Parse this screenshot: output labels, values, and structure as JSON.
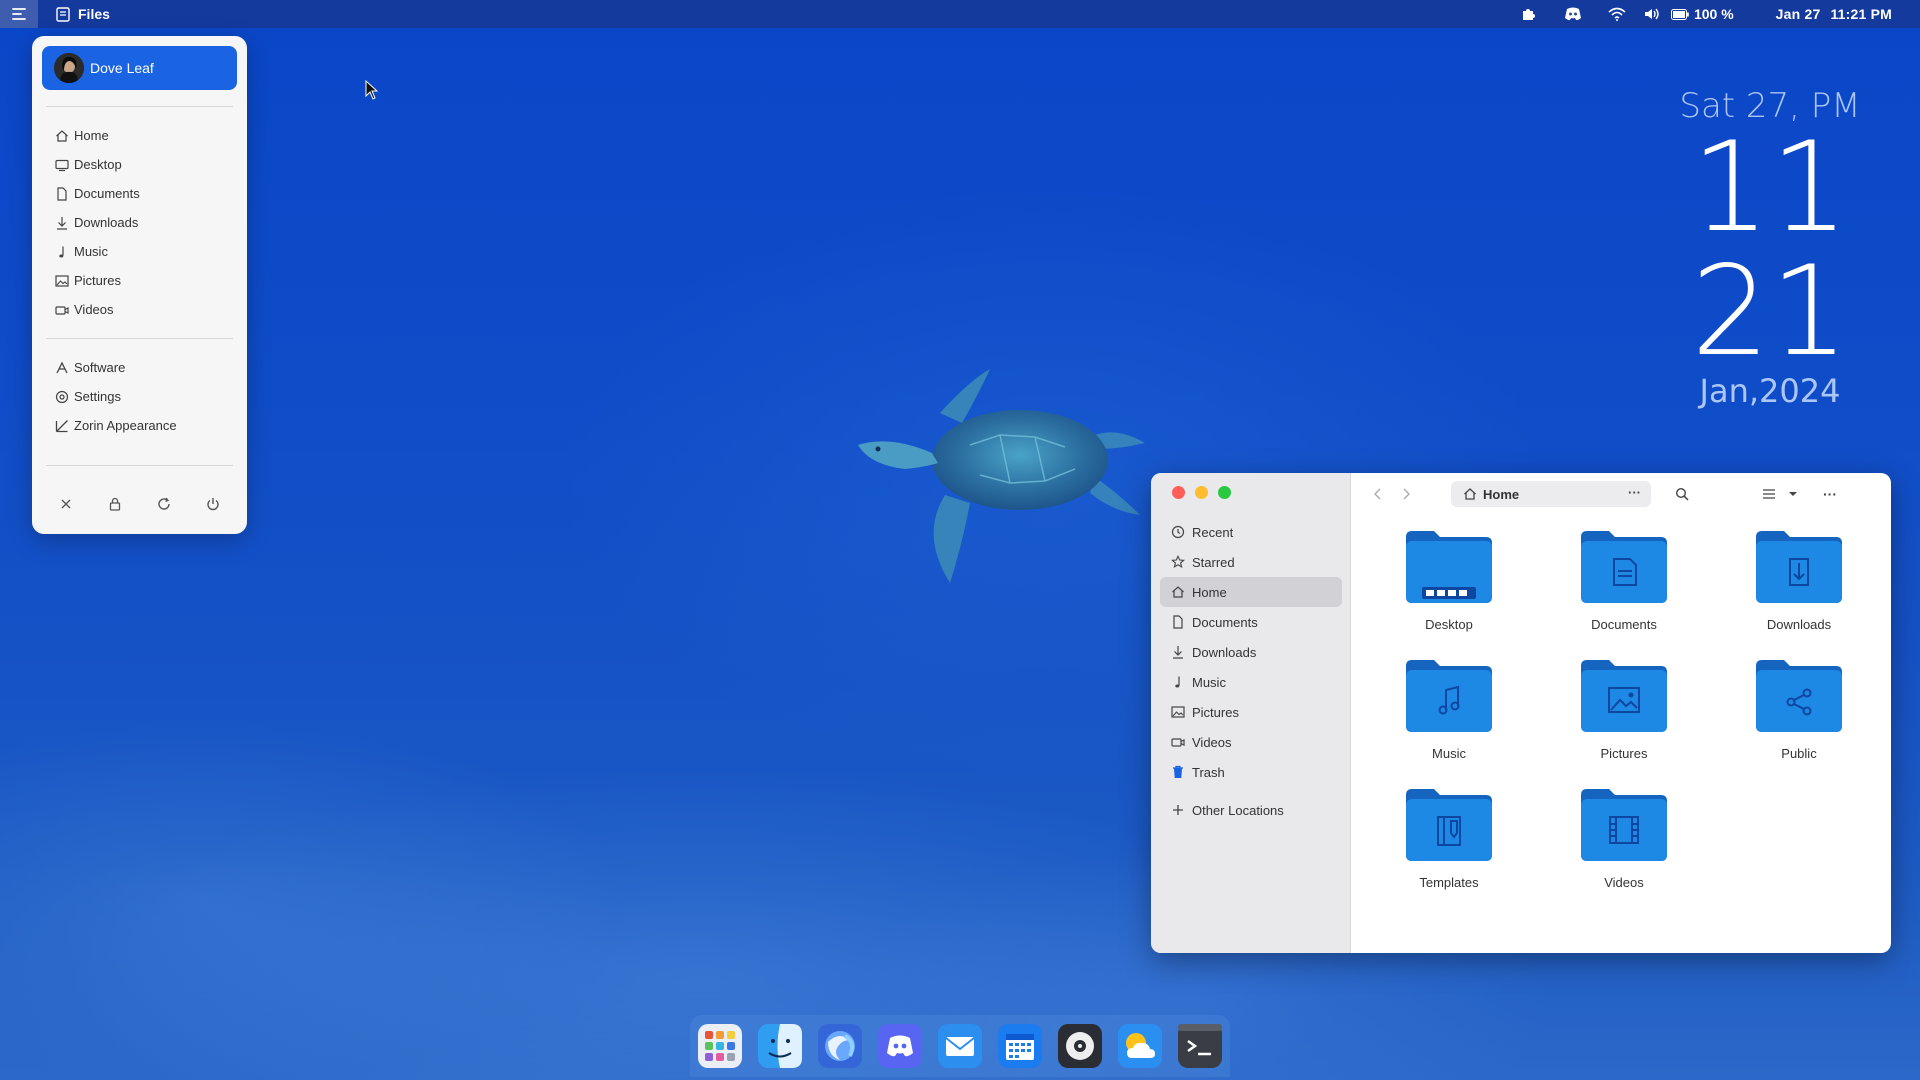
{
  "topbar": {
    "app_name": "Files",
    "battery": "100 %",
    "date": "Jan 27",
    "time": "11:21 PM",
    "icons": [
      "menu-icon",
      "files-app-icon",
      "puzzle-icon",
      "discord-tray-icon",
      "wifi-icon",
      "volume-icon",
      "battery-icon"
    ]
  },
  "clock_widget": {
    "day": "Sat 27, PM",
    "hour": "11",
    "minute": "21",
    "date": "Jan,2024"
  },
  "start_menu": {
    "user": "Dove Leaf",
    "places": [
      {
        "label": "Home",
        "icon": "home-icon"
      },
      {
        "label": "Desktop",
        "icon": "desktop-icon"
      },
      {
        "label": "Documents",
        "icon": "document-icon"
      },
      {
        "label": "Downloads",
        "icon": "download-icon"
      },
      {
        "label": "Music",
        "icon": "music-icon"
      },
      {
        "label": "Pictures",
        "icon": "picture-icon"
      },
      {
        "label": "Videos",
        "icon": "video-icon"
      }
    ],
    "apps": [
      {
        "label": "Software",
        "icon": "software-icon"
      },
      {
        "label": "Settings",
        "icon": "settings-icon"
      },
      {
        "label": "Zorin Appearance",
        "icon": "appearance-icon"
      }
    ],
    "power_icons": [
      "close-icon",
      "lock-icon",
      "restart-icon",
      "power-icon"
    ]
  },
  "file_manager": {
    "path": "Home",
    "sidebar": [
      {
        "label": "Recent",
        "icon": "clock-icon"
      },
      {
        "label": "Starred",
        "icon": "star-icon"
      },
      {
        "label": "Home",
        "icon": "home-icon",
        "active": true
      },
      {
        "label": "Documents",
        "icon": "document-icon"
      },
      {
        "label": "Downloads",
        "icon": "download-icon"
      },
      {
        "label": "Music",
        "icon": "music-icon"
      },
      {
        "label": "Pictures",
        "icon": "picture-icon"
      },
      {
        "label": "Videos",
        "icon": "video-icon"
      },
      {
        "label": "Trash",
        "icon": "trash-icon"
      }
    ],
    "other_locations": "Other Locations",
    "items": [
      {
        "label": "Desktop",
        "icon": "desktop-folder-icon"
      },
      {
        "label": "Documents",
        "icon": "documents-folder-icon"
      },
      {
        "label": "Downloads",
        "icon": "downloads-folder-icon"
      },
      {
        "label": "Music",
        "icon": "music-folder-icon"
      },
      {
        "label": "Pictures",
        "icon": "pictures-folder-icon"
      },
      {
        "label": "Public",
        "icon": "public-folder-icon"
      },
      {
        "label": "Templates",
        "icon": "templates-folder-icon"
      },
      {
        "label": "Videos",
        "icon": "videos-folder-icon"
      }
    ]
  },
  "dock": {
    "apps": [
      "app-grid-icon",
      "finder-icon",
      "browser-icon",
      "discord-icon",
      "mail-icon",
      "calendar-icon",
      "music-player-icon",
      "weather-icon",
      "terminal-icon"
    ]
  },
  "colors": {
    "accent": "#1a63e2",
    "folder": "#1e88e5",
    "close": "#ff5f57",
    "minimize": "#febc2e",
    "maximize": "#28c840"
  }
}
